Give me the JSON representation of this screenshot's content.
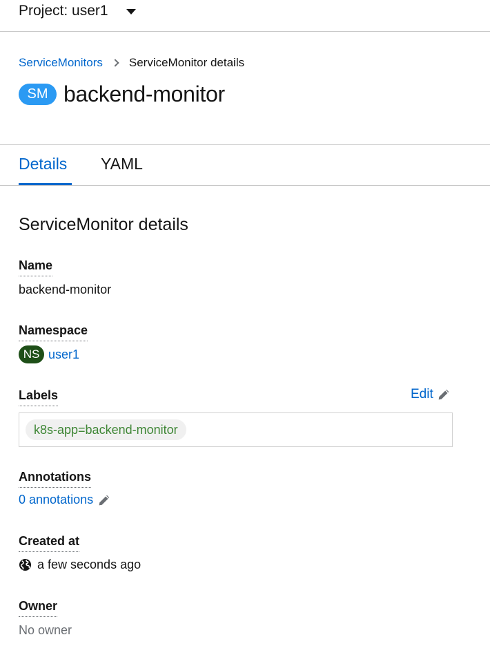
{
  "project": {
    "label": "Project: user1"
  },
  "breadcrumb": {
    "parent": "ServiceMonitors",
    "current": "ServiceMonitor details"
  },
  "resource": {
    "badge": "SM",
    "name": "backend-monitor"
  },
  "tabs": [
    {
      "label": "Details"
    },
    {
      "label": "YAML"
    }
  ],
  "section": {
    "title": "ServiceMonitor details"
  },
  "fields": {
    "name": {
      "label": "Name",
      "value": "backend-monitor"
    },
    "namespace": {
      "label": "Namespace",
      "badge": "NS",
      "value": "user1"
    },
    "labels": {
      "label": "Labels",
      "edit_label": "Edit",
      "items": [
        "k8s-app=backend-monitor"
      ]
    },
    "annotations": {
      "label": "Annotations",
      "value": "0 annotations"
    },
    "created": {
      "label": "Created at",
      "value": "a few seconds ago"
    },
    "owner": {
      "label": "Owner",
      "value": "No owner"
    }
  },
  "colors": {
    "link": "#0066cc",
    "sm_badge": "#2b9af3",
    "ns_badge": "#1e4f18",
    "label_text": "#3e8635"
  },
  "icons": {
    "edit": "pencil-icon",
    "created": "globe-icon",
    "project": "caret-down-icon",
    "breadcrumb": "chevron-right-icon"
  }
}
